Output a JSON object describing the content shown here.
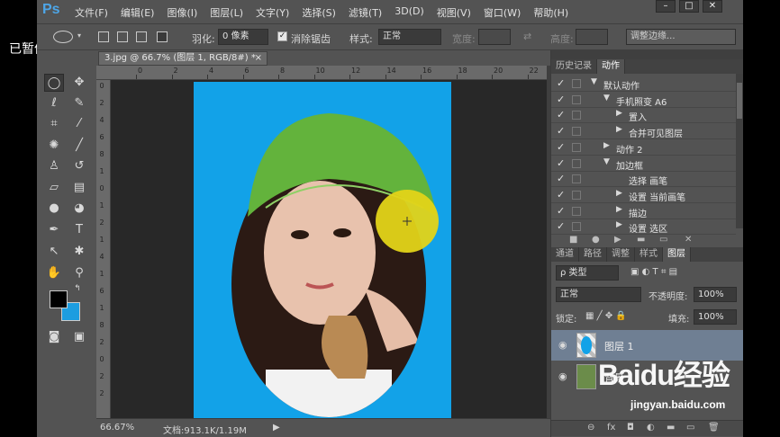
{
  "overlay": {
    "paused_label": "已暂停"
  },
  "app": {
    "logo": "Ps"
  },
  "menu": [
    "文件(F)",
    "编辑(E)",
    "图像(I)",
    "图层(L)",
    "文字(Y)",
    "选择(S)",
    "滤镜(T)",
    "3D(D)",
    "视图(V)",
    "窗口(W)",
    "帮助(H)"
  ],
  "window_controls": [
    "–",
    "□",
    "✕"
  ],
  "options": {
    "feather_label": "羽化:",
    "feather_value": "0 像素",
    "antialias_label": "消除锯齿",
    "antialias_checked": "✓",
    "style_label": "样式:",
    "style_value": "正常",
    "width_label": "宽度:",
    "height_label": "高度:",
    "refine_edge": "调整边缘..."
  },
  "document": {
    "tab_title": "3.jpg @ 66.7% (图层 1, RGB/8#) *",
    "close_glyph": "×"
  },
  "ruler": {
    "top": [
      "0",
      "2",
      "4",
      "6",
      "8",
      "10",
      "12",
      "14",
      "16",
      "18",
      "20",
      "22"
    ],
    "left": [
      "0",
      "2",
      "4",
      "6",
      "8",
      "1",
      "0",
      "1",
      "2",
      "1",
      "4",
      "1",
      "6",
      "1",
      "8",
      "2",
      "0",
      "2",
      "2"
    ]
  },
  "status": {
    "zoom": "66.67%",
    "doc_info": "文档:913.1K/1.19M",
    "arrow": "▶"
  },
  "history_panel": {
    "tabs": [
      "历史记录",
      "动作"
    ],
    "actions": [
      {
        "label": "默认动作",
        "arrow": "▼",
        "indent": 0
      },
      {
        "label": "手机照变 A6",
        "arrow": "▼",
        "indent": 1
      },
      {
        "label": "置入",
        "arrow": "▶",
        "indent": 2
      },
      {
        "label": "合并可见图层",
        "arrow": "▶",
        "indent": 2
      },
      {
        "label": "动作 2",
        "arrow": "▶",
        "indent": 1
      },
      {
        "label": "加边框",
        "arrow": "▼",
        "indent": 1
      },
      {
        "label": "选择 画笔",
        "arrow": "",
        "indent": 2
      },
      {
        "label": "设置 当前画笔",
        "arrow": "▶",
        "indent": 2
      },
      {
        "label": "描边",
        "arrow": "▶",
        "indent": 2
      },
      {
        "label": "设置 选区",
        "arrow": "▶",
        "indent": 2
      }
    ],
    "check": "✓"
  },
  "layers_panel": {
    "tabs": [
      "通道",
      "路径",
      "调整",
      "样式",
      "图层"
    ],
    "filter_value": "ρ 类型",
    "blend_mode": "正常",
    "opacity_label": "不透明度:",
    "opacity_value": "100%",
    "lock_label": "锁定:",
    "fill_label": "填充:",
    "fill_value": "100%",
    "layers": [
      {
        "name": "图层 1",
        "selected": true
      },
      {
        "name": "背景",
        "selected": false
      }
    ],
    "eye": "◉",
    "footer_icons": [
      "⊖",
      "fx",
      "◘",
      "◐",
      "▬",
      "▭",
      "🗑"
    ]
  },
  "watermark": {
    "brand": "Baidu经验",
    "url": "jingyan.baidu.com"
  },
  "colors": {
    "app_bg": "#535353",
    "canvas_bg": "#12a2e8",
    "accent": "#4da6e8",
    "selected_layer": "#6f7f93"
  }
}
